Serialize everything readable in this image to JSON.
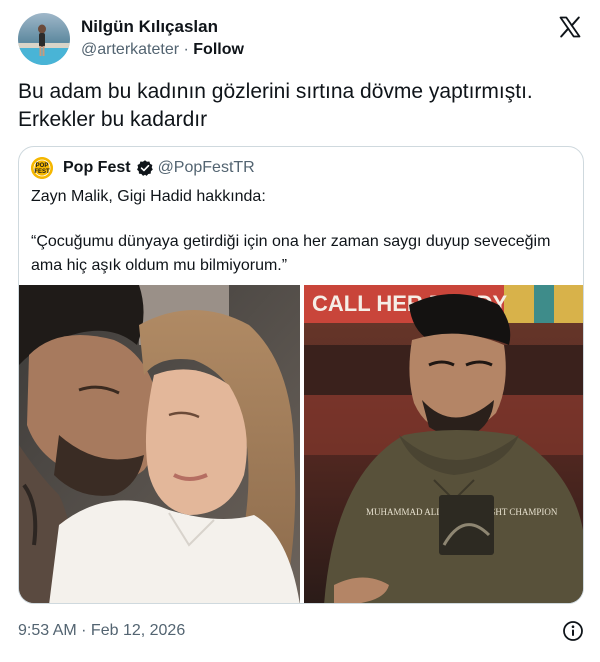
{
  "tweet": {
    "author_name": "Nilgün Kılıçaslan",
    "author_handle": "@arterkateter",
    "separator": " · ",
    "follow_label": "Follow",
    "text_line1": "Bu adam bu kadının gözlerini sırtına dövme yaptırmıştı.",
    "text_line2": "Erkekler bu kadardır",
    "timestamp": "9:53 AM · Feb 12, 2026"
  },
  "quote": {
    "author_name": "Pop Fest",
    "author_handle": "@PopFestTR",
    "logo_text": "POP FEST",
    "line1": "Zayn Malik, Gigi Hadid hakkında:",
    "line2": "“Çocuğumu dünyaya getirdiği için ona her zaman saygı duyup seveceğim ama hiç aşık oldum mu bilmiyorum.”"
  },
  "media": {
    "sign_text": "CALL HER DADDY",
    "hoodie_text": "MUHAMMAD ALI HEAVYWEIGHT CHAMPION"
  },
  "icons": {
    "x_logo": "x-logo-icon",
    "verified": "verified-badge-icon",
    "info": "info-icon"
  },
  "colors": {
    "text": "#0f1419",
    "secondary": "#536471",
    "border": "#cfd9de",
    "verified_gold": "#e2b719",
    "pop_fest_yellow": "#f5b700"
  }
}
